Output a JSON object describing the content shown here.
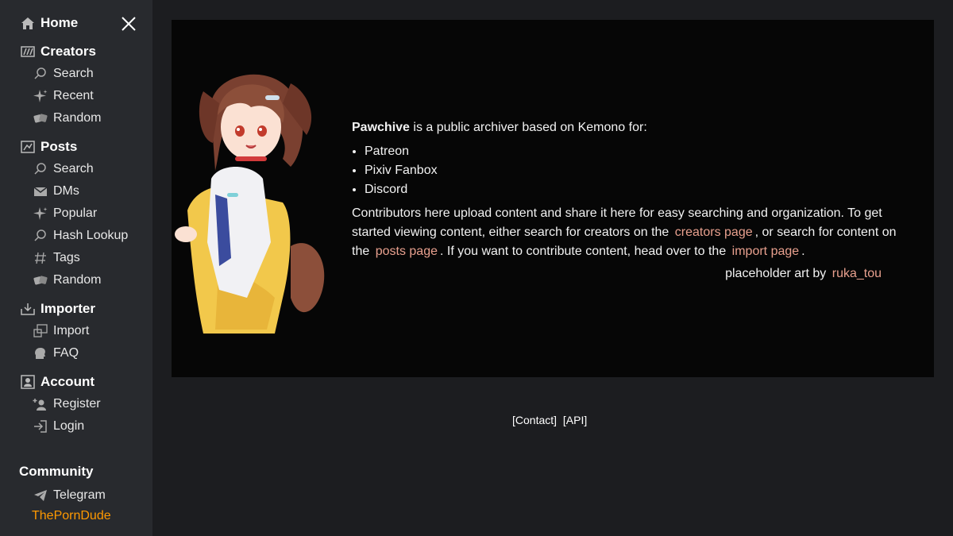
{
  "sidebar": {
    "home": {
      "label": "Home"
    },
    "creators": {
      "label": "Creators",
      "items": [
        {
          "label": "Search"
        },
        {
          "label": "Recent"
        },
        {
          "label": "Random"
        }
      ]
    },
    "posts": {
      "label": "Posts",
      "items": [
        {
          "label": "Search"
        },
        {
          "label": "DMs"
        },
        {
          "label": "Popular"
        },
        {
          "label": "Hash Lookup"
        },
        {
          "label": "Tags"
        },
        {
          "label": "Random"
        }
      ]
    },
    "importer": {
      "label": "Importer",
      "items": [
        {
          "label": "Import"
        },
        {
          "label": "FAQ"
        }
      ]
    },
    "account": {
      "label": "Account",
      "items": [
        {
          "label": "Register"
        },
        {
          "label": "Login"
        }
      ]
    },
    "community": {
      "label": "Community",
      "items": [
        {
          "label": "Telegram"
        },
        {
          "label": "ThePornDude"
        }
      ]
    }
  },
  "main": {
    "brand": "Pawchive",
    "intro_rest": " is a public archiver based on Kemono for:",
    "services": [
      "Patreon",
      "Pixiv Fanbox",
      "Discord"
    ],
    "desc_1": "Contributors here upload content and share it here for easy searching and organization. To get started viewing content, either search for creators on the",
    "creators_link": "creators page",
    "desc_2": ", or search for content on the",
    "posts_link": "posts page",
    "desc_3": ". If you want to contribute content, head over to the",
    "import_link": "import page",
    "desc_4": ".",
    "credit_prefix": "placeholder art by",
    "credit_link": "ruka_tou"
  },
  "footer": {
    "contact": "[Contact]",
    "api": "[API]"
  },
  "colors": {
    "link": "#e8a08e",
    "porndude": "#ff9900",
    "sidebar_bg": "#282a2e",
    "card_bg": "#060606"
  }
}
